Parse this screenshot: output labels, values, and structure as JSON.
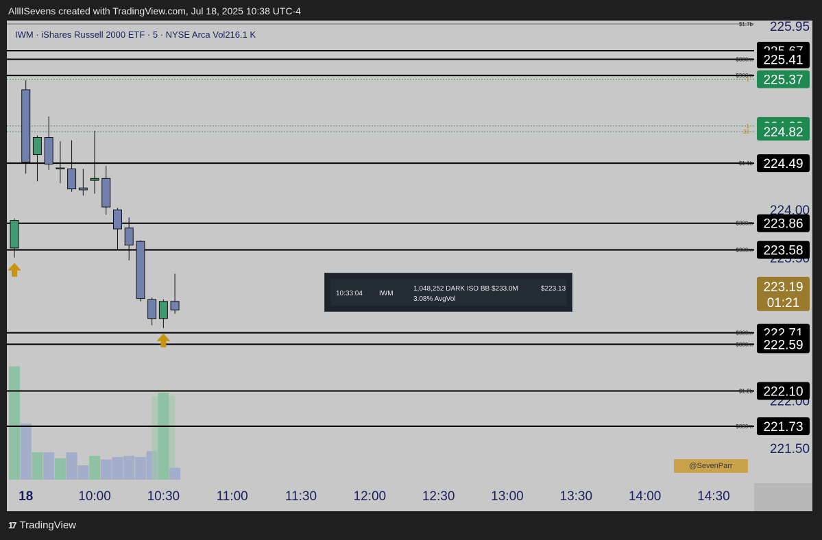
{
  "header": {
    "caption": "AlllISevens created with TradingView.com, Jul 18, 2025 10:38 UTC-4"
  },
  "legend": {
    "symbol_line": "IWM · iShares Russell 2000 ETF · 5 · NYSE Arca  Vol216.1 K"
  },
  "footer": {
    "brand": "TradingView",
    "logo": "17"
  },
  "watermark": {
    "text": "@SevenParr"
  },
  "tooltip": {
    "time": "10:33:04",
    "ticker": "IWM",
    "detail": "1,048,252 DARK ISO BB $233.0M",
    "sub": "3.08% AvgVol",
    "price": "$223.13"
  },
  "colors": {
    "background": "#c8c8c8",
    "up_candle": "#3f9b6f",
    "down_candle": "#7180ad",
    "arrow": "#c8940f",
    "level_tag": "#000000",
    "alert_tag": "#1e8a52",
    "current_tag": "#9a7a2c"
  },
  "chart_data": {
    "type": "candlestick",
    "symbol": "IWM",
    "interval": "5",
    "ylim": [
      221.2,
      226.0
    ],
    "y_ticks": [
      224.0,
      221.5
    ],
    "hidden_ticks": [
      {
        "price": 225.93,
        "label": "225.95"
      },
      {
        "price": 223.5,
        "label": "223.50"
      },
      {
        "price": 222.0,
        "label": "222.00"
      }
    ],
    "x_ticks": [
      {
        "bar": 1,
        "label": "18",
        "bold": true
      },
      {
        "bar": 7,
        "label": "10:00"
      },
      {
        "bar": 13,
        "label": "10:30"
      },
      {
        "bar": 19,
        "label": "11:00"
      },
      {
        "bar": 25,
        "label": "11:30"
      },
      {
        "bar": 31,
        "label": "12:00"
      },
      {
        "bar": 37,
        "label": "12:30"
      },
      {
        "bar": 43,
        "label": "13:00"
      },
      {
        "bar": 49,
        "label": "13:30"
      },
      {
        "bar": 55,
        "label": "14:00"
      },
      {
        "bar": 61,
        "label": "14:30"
      }
    ],
    "candles": [
      {
        "o": 223.6,
        "h": 223.91,
        "l": 223.5,
        "c": 223.89,
        "v": 95
      },
      {
        "o": 225.26,
        "h": 225.36,
        "l": 224.38,
        "c": 224.5,
        "v": 47
      },
      {
        "o": 224.58,
        "h": 224.78,
        "l": 224.3,
        "c": 224.76,
        "v": 23
      },
      {
        "o": 224.76,
        "h": 224.98,
        "l": 224.42,
        "c": 224.48,
        "v": 23
      },
      {
        "o": 224.44,
        "h": 224.72,
        "l": 224.28,
        "c": 224.44,
        "v": 18
      },
      {
        "o": 224.43,
        "h": 224.73,
        "l": 224.19,
        "c": 224.22,
        "v": 23
      },
      {
        "o": 224.23,
        "h": 224.43,
        "l": 224.15,
        "c": 224.21,
        "v": 12
      },
      {
        "o": 224.31,
        "h": 224.83,
        "l": 224.17,
        "c": 224.33,
        "v": 20
      },
      {
        "o": 224.33,
        "h": 224.46,
        "l": 223.95,
        "c": 224.03,
        "v": 17
      },
      {
        "o": 224.0,
        "h": 224.02,
        "l": 223.58,
        "c": 223.8,
        "v": 19
      },
      {
        "o": 223.81,
        "h": 223.92,
        "l": 223.47,
        "c": 223.63,
        "v": 20
      },
      {
        "o": 223.67,
        "h": 223.68,
        "l": 223.04,
        "c": 223.07,
        "v": 19
      },
      {
        "o": 223.06,
        "h": 223.08,
        "l": 222.79,
        "c": 222.86,
        "v": 24
      },
      {
        "o": 222.86,
        "h": 223.06,
        "l": 222.76,
        "c": 223.04,
        "v": 73
      },
      {
        "o": 223.04,
        "h": 223.33,
        "l": 222.91,
        "c": 222.95,
        "v": 10
      }
    ],
    "levels": [
      {
        "price": 225.95,
        "label": "$1.7b",
        "tag": "225.95",
        "hidden": true
      },
      {
        "price": 225.67,
        "label": "",
        "tag": "225.67"
      },
      {
        "price": 225.58,
        "label": "$800m",
        "tag": "225.41"
      },
      {
        "price": 225.41,
        "label": "$900m",
        "tag": ""
      },
      {
        "price": 224.49,
        "label": "$1.1b",
        "tag": "224.49"
      },
      {
        "price": 223.86,
        "label": "$800m",
        "tag": "223.86"
      },
      {
        "price": 223.58,
        "label": "$900m",
        "tag": "223.58"
      },
      {
        "price": 222.71,
        "label": "$800m",
        "tag": "222.71"
      },
      {
        "price": 222.59,
        "label": "$800m",
        "tag": "222.59"
      },
      {
        "price": 222.1,
        "label": "$1.2b",
        "tag": "222.10"
      },
      {
        "price": 221.73,
        "label": "$800m",
        "tag": "221.73"
      }
    ],
    "alerts": [
      {
        "price": 225.37,
        "tag": "225.37",
        "marker": "1"
      },
      {
        "price": 224.88,
        "tag": "224.88",
        "marker": "1"
      },
      {
        "price": 224.82,
        "tag": "224.82",
        "marker": "30"
      }
    ],
    "current": {
      "price": 223.19,
      "countdown": "01:21"
    },
    "arrows": [
      {
        "bar": 0
      },
      {
        "bar": 13
      }
    ],
    "volume_highlight": [
      13
    ]
  }
}
